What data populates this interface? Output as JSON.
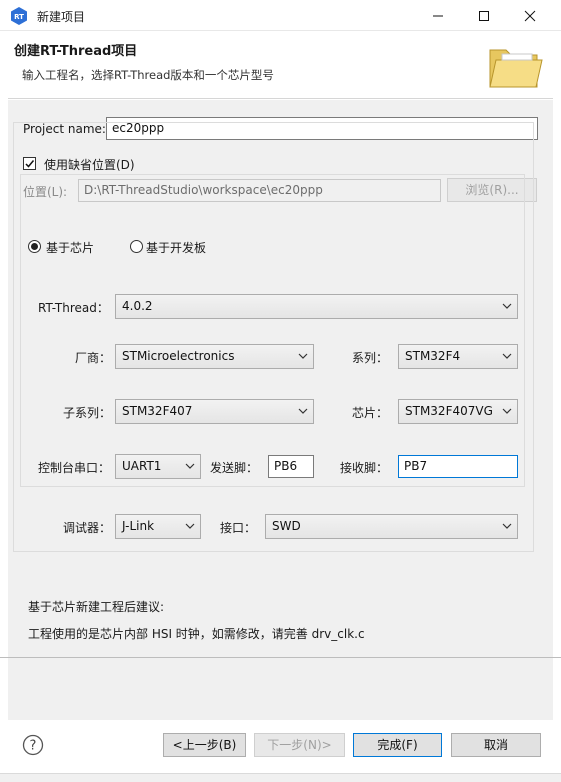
{
  "window": {
    "title": "新建项目",
    "icons": {
      "app": "rt-thread-logo-icon",
      "minimize": "minimize-icon",
      "maximize": "maximize-icon",
      "close": "close-icon"
    }
  },
  "header": {
    "title": "创建RT-Thread项目",
    "description": "输入工程名，选择RT-Thread版本和一个芯片型号",
    "icon": "folder-icon"
  },
  "project": {
    "name_label": "Project name:",
    "name_value": "ec20ppp",
    "use_default_label": "使用缺省位置(D)",
    "use_default_checked": true,
    "location_label": "位置(L):",
    "location_value": "D:\\RT-ThreadStudio\\workspace\\ec20ppp",
    "browse_label": "浏览(R)..."
  },
  "mode": {
    "chip_label": "基于芯片",
    "board_label": "基于开发板",
    "selected": "chip"
  },
  "config": {
    "rtthread_label": "RT-Thread：",
    "rtthread_value": "4.0.2",
    "vendor_label": "厂商：",
    "vendor_value": "STMicroelectronics",
    "series_label": "系列：",
    "series_value": "STM32F4",
    "subseries_label": "子系列：",
    "subseries_value": "STM32F407",
    "chip_label": "芯片：",
    "chip_value": "STM32F407VG",
    "console_label": "控制台串口：",
    "console_value": "UART1",
    "tx_label": "发送脚：",
    "tx_value": "PB6",
    "rx_label": "接收脚：",
    "rx_value": "PB7",
    "debugger_label": "调试器：",
    "debugger_value": "J-Link",
    "interface_label": "接口：",
    "interface_value": "SWD"
  },
  "advice": {
    "title": "基于芯片新建工程后建议:",
    "text": "工程使用的是芯片内部 HSI 时钟，如需修改，请完善 drv_clk.c"
  },
  "footer": {
    "help_icon": "help-icon",
    "back_label": "<上一步(B)",
    "next_label": "下一步(N)>",
    "finish_label": "完成(F)",
    "cancel_label": "取消"
  },
  "colors": {
    "accent": "#0078d7",
    "panel": "#f0f0f0",
    "logo": "#2d6fd6"
  }
}
